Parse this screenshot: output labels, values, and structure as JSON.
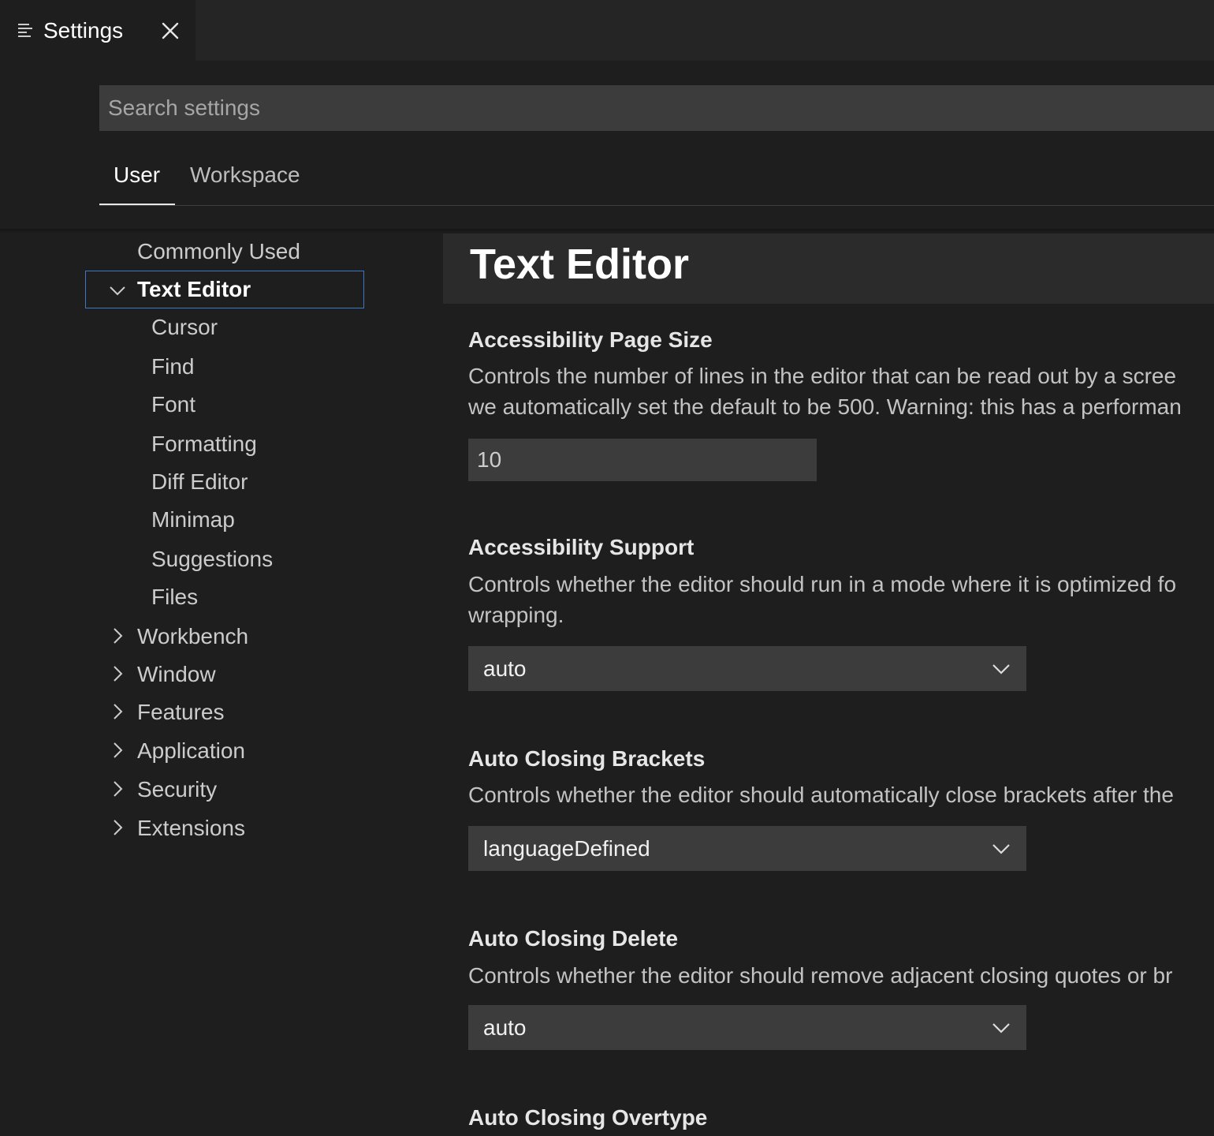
{
  "tab": {
    "title": "Settings",
    "icon": "settings-list-icon",
    "close_icon": "close-icon"
  },
  "search": {
    "placeholder": "Search settings",
    "value": ""
  },
  "scope": {
    "tabs": [
      "User",
      "Workspace"
    ],
    "active": "User"
  },
  "toc": {
    "items": [
      {
        "label": "Commonly Used"
      },
      {
        "label": "Text Editor",
        "expanded": true,
        "selected": true
      },
      {
        "label": "Cursor"
      },
      {
        "label": "Find"
      },
      {
        "label": "Font"
      },
      {
        "label": "Formatting"
      },
      {
        "label": "Diff Editor"
      },
      {
        "label": "Minimap"
      },
      {
        "label": "Suggestions"
      },
      {
        "label": "Files"
      },
      {
        "label": "Workbench",
        "expanded": false
      },
      {
        "label": "Window",
        "expanded": false
      },
      {
        "label": "Features",
        "expanded": false
      },
      {
        "label": "Application",
        "expanded": false
      },
      {
        "label": "Security",
        "expanded": false
      },
      {
        "label": "Extensions",
        "expanded": false
      }
    ]
  },
  "content": {
    "section_title": "Text Editor",
    "settings": [
      {
        "title": "Accessibility Page Size",
        "desc_lines": [
          "Controls the number of lines in the editor that can be read out by a scree",
          "we automatically set the default to be 500. Warning: this has a performan"
        ],
        "value": "10"
      },
      {
        "title": "Accessibility Support",
        "desc_lines": [
          "Controls whether the editor should run in a mode where it is optimized fo",
          "wrapping."
        ],
        "value": "auto"
      },
      {
        "title": "Auto Closing Brackets",
        "desc_lines": [
          "Controls whether the editor should automatically close brackets after the"
        ],
        "value": "languageDefined"
      },
      {
        "title": "Auto Closing Delete",
        "desc_lines": [
          "Controls whether the editor should remove adjacent closing quotes or br"
        ],
        "value": "auto"
      },
      {
        "title": "Auto Closing Overtype",
        "desc_lines": []
      }
    ]
  },
  "colors": {
    "background": "#1e1e1e",
    "tabbar": "#252526",
    "input": "#3c3c3c",
    "focus_border": "#3a78c7",
    "section_header": "#2b2b2b"
  }
}
